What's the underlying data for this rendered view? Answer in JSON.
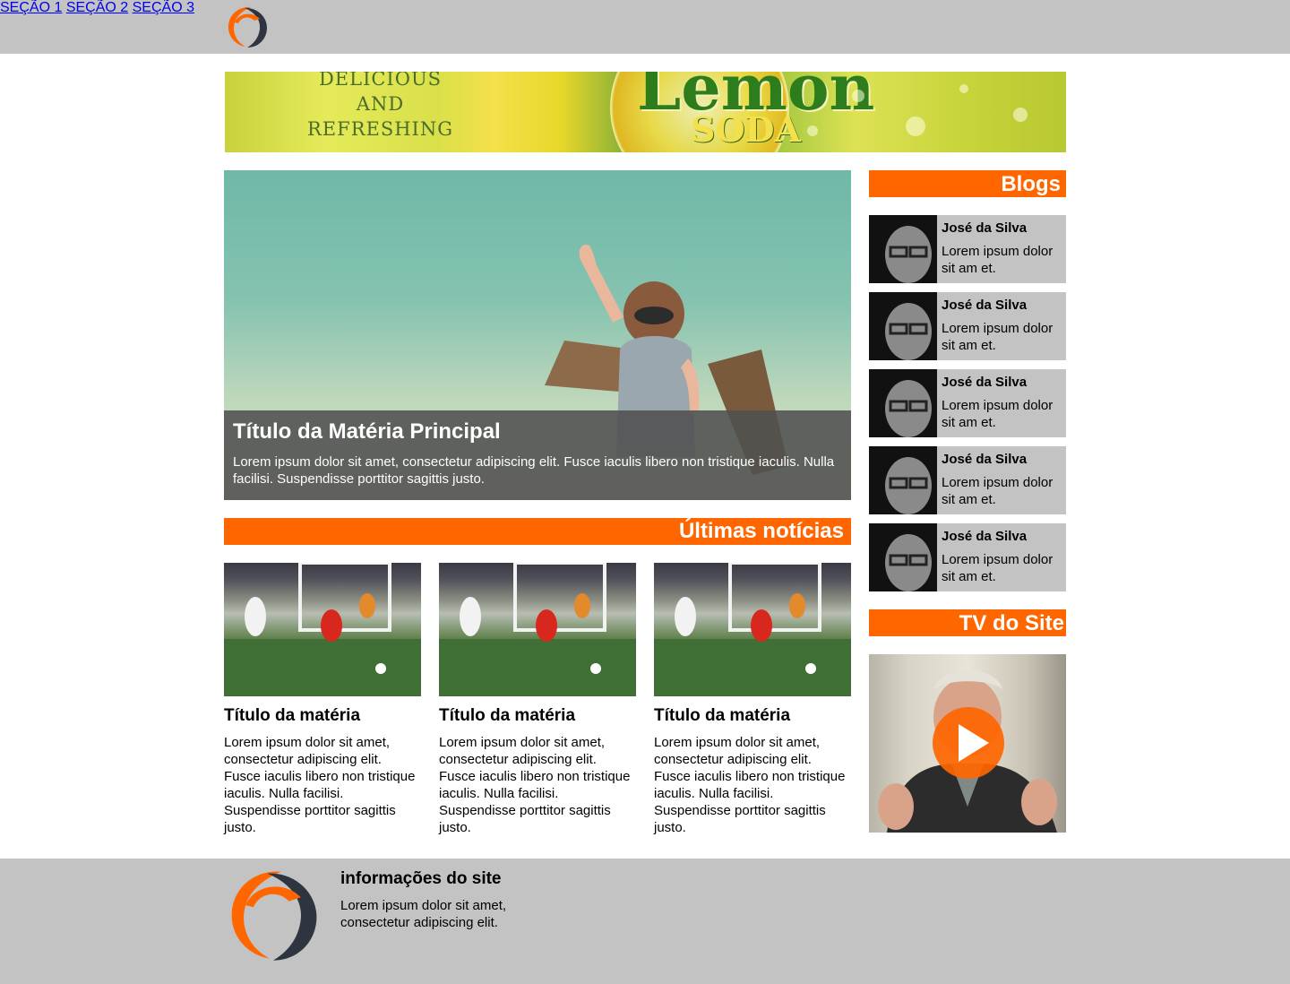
{
  "header": {
    "logo_icon": "brand-logo",
    "nav": [
      {
        "label": "SEÇÃO 1"
      },
      {
        "label": "SEÇÃO 2"
      },
      {
        "label": "SEÇÃO 3"
      }
    ]
  },
  "banner": {
    "line1": "DELICIOUS",
    "line2": "AND",
    "line3": "REFRESHING",
    "brand": "Lemon",
    "product": "SODA"
  },
  "hero": {
    "title": "Título da Matéria Principal",
    "text": "Lorem ipsum dolor sit amet, consectetur adipiscing elit. Fusce iaculis libero non tristique iaculis. Nulla facilisi. Suspendisse porttitor sagittis justo."
  },
  "latest": {
    "heading": "Últimas notícias",
    "items": [
      {
        "title": "Título da matéria",
        "text": "Lorem ipsum dolor sit amet, consectetur adipiscing elit. Fusce iaculis libero non tristique iaculis. Nulla facilisi. Suspendisse porttitor sagittis justo."
      },
      {
        "title": "Título da matéria",
        "text": "Lorem ipsum dolor sit amet, consectetur adipiscing elit. Fusce iaculis libero non tristique iaculis. Nulla facilisi. Suspendisse porttitor sagittis justo."
      },
      {
        "title": "Título da matéria",
        "text": "Lorem ipsum dolor sit amet, consectetur adipiscing elit. Fusce iaculis libero non tristique iaculis. Nulla facilisi. Suspendisse porttitor sagittis justo."
      }
    ]
  },
  "blogs": {
    "heading": "Blogs",
    "items": [
      {
        "name": "José da Silva",
        "text": "Lorem ipsum dolor sit am et."
      },
      {
        "name": "José da Silva",
        "text": "Lorem ipsum dolor sit am et."
      },
      {
        "name": "José da Silva",
        "text": "Lorem ipsum dolor sit am et."
      },
      {
        "name": "José da Silva",
        "text": "Lorem ipsum dolor sit am et."
      },
      {
        "name": "José da Silva",
        "text": "Lorem ipsum dolor sit am et."
      }
    ]
  },
  "tv": {
    "heading": "TV do Site",
    "play_icon": "play-icon"
  },
  "footer": {
    "title": "informações do site",
    "text": "Lorem ipsum dolor sit amet, consectetur adipiscing elit."
  },
  "colors": {
    "accent": "#ff6600",
    "gray": "#c3c3c3",
    "logo_dark": "#2e3440"
  }
}
